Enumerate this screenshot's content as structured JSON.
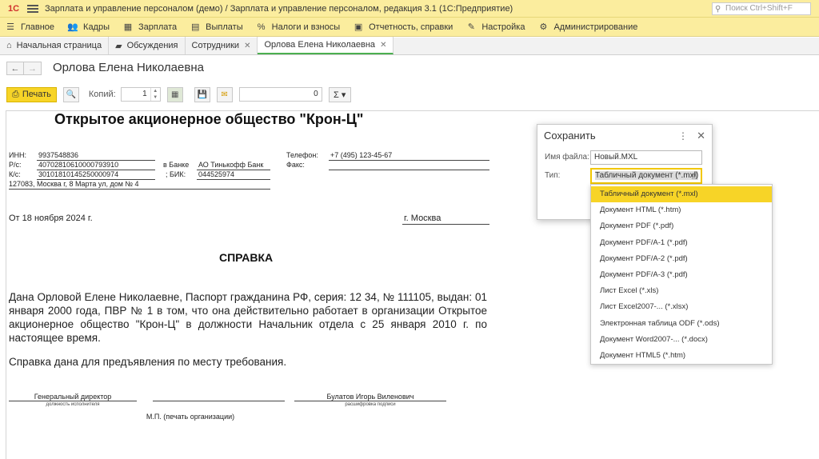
{
  "titlebar": {
    "logo": "1С",
    "title": "Зарплата и управление персоналом (демо) / Зарплата и управление персоналом, редакция 3.1  (1С:Предприятие)",
    "search_placeholder": "Поиск Ctrl+Shift+F"
  },
  "sections": [
    {
      "label": "Главное",
      "icon": "home-icon"
    },
    {
      "label": "Кадры",
      "icon": "people-icon"
    },
    {
      "label": "Зарплата",
      "icon": "calculator-icon"
    },
    {
      "label": "Выплаты",
      "icon": "wallet-icon"
    },
    {
      "label": "Налоги и взносы",
      "icon": "percent-icon"
    },
    {
      "label": "Отчетность, справки",
      "icon": "report-icon"
    },
    {
      "label": "Настройка",
      "icon": "wrench-icon"
    },
    {
      "label": "Администрирование",
      "icon": "gear-icon"
    }
  ],
  "tabs": [
    {
      "label": "Начальная страница",
      "icon": "home-icon"
    },
    {
      "label": "Обсуждения",
      "icon": "chat-icon"
    },
    {
      "label": "Сотрудники",
      "closable": true
    },
    {
      "label": "Орлова Елена Николаевна",
      "closable": true,
      "active": true
    }
  ],
  "form": {
    "title": "Орлова Елена Николаевна"
  },
  "toolbar": {
    "print_label": "Печать",
    "copies_label": "Копий:",
    "copies_value": "1",
    "number_value": "0",
    "sum_label": "Σ ▾"
  },
  "document": {
    "org_name": "Открытое акционерное общество \"Крон-Ц\"",
    "inn_label": "ИНН:",
    "inn": "9937548836",
    "rs_label": "Р/с:",
    "rs": "40702810610000793910",
    "ks_label": "К/с:",
    "ks": "30101810145250000974",
    "address": "127083, Москва г, 8 Марта ул, дом № 4",
    "bank_label": "в Банке",
    "bank": "АО Тинькофф Банк",
    "bik_label": "; БИК:",
    "bik": "044525974",
    "phone_label": "Телефон:",
    "phone": "+7 (495) 123-45-67",
    "fax_label": "Факс:",
    "date": "От 18 ноября 2024 г.",
    "city": "г. Москва",
    "heading": "СПРАВКА",
    "body": "Дана Орловой Елене Николаевне, Паспорт гражданина РФ, серия: 12 34, № 111105, выдан: 01 января 2000 года, ПВР № 1 в том, что она действительно работает в организации Открытое акционерное общество \"Крон-Ц\" в должности Начальник отдела с 25 января 2010 г. по настоящее время.",
    "purpose": "Справка дана для предъявления по месту требования.",
    "signer_position": "Генеральный директор",
    "signer_position_caption": "должность исполнителя",
    "signer_name": "Булатов Игорь Виленович",
    "signer_name_caption": "расшифровка подписи",
    "stamp": "М.П. (печать организации)"
  },
  "save_dialog": {
    "title": "Сохранить",
    "filename_label": "Имя файла:",
    "filename": "Новый.MXL",
    "type_label": "Тип:",
    "type_value": "Табличный документ (*.mxl)",
    "options": [
      "Табличный документ (*.mxl)",
      "Документ HTML (*.htm)",
      "Документ PDF (*.pdf)",
      "Документ PDF/A-1 (*.pdf)",
      "Документ PDF/A-2 (*.pdf)",
      "Документ PDF/A-3 (*.pdf)",
      "Лист Excel (*.xls)",
      "Лист Excel2007-... (*.xlsx)",
      "Электронная таблица ODF (*.ods)",
      "Документ Word2007-... (*.docx)",
      "Документ HTML5 (*.htm)"
    ]
  },
  "colors": {
    "header_bg": "#fbed9e",
    "accent_yellow": "#f7d427",
    "active_tab_underline": "#4caf50",
    "logo_red": "#d0312d"
  }
}
